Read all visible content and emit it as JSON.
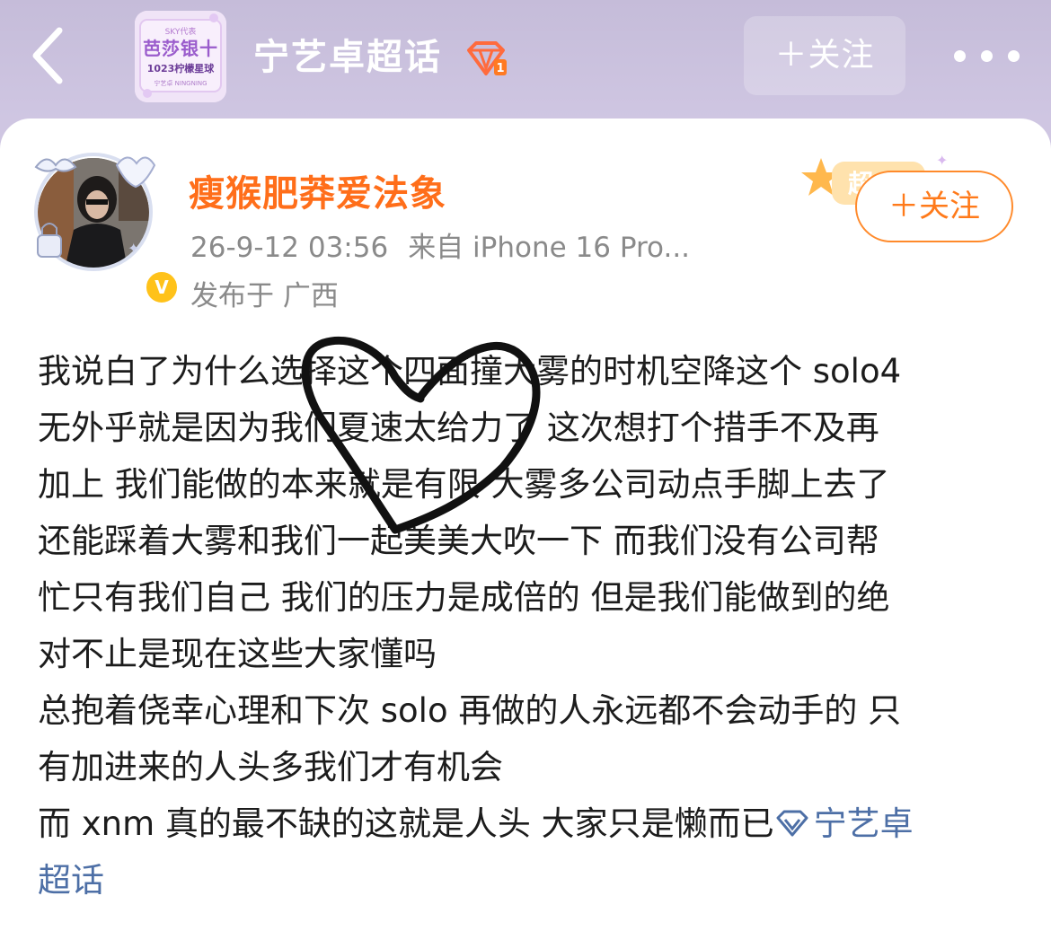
{
  "header": {
    "title": "宁艺卓超话",
    "follow_label": "＋关注",
    "thumb": {
      "top_text": "SKY代表",
      "main_text": "芭莎银十",
      "sub_text": "1023柠檬星球",
      "tiny_text": "宁艺卓 NINGNING"
    },
    "icons": {
      "back": "chevron-left-icon",
      "diamond": "diamond-badge-icon",
      "more": "more-dots-icon"
    }
  },
  "post": {
    "author": "瘦猴肥莽爱法象",
    "timestamp": "26-9-12 03:56",
    "source": "来自 iPhone 16 Pro...",
    "location": "发布于 广西",
    "follow_label": "＋关注",
    "verified_mark": "V",
    "lines": [
      "我说白了为什么选择这个四面撞大雾的时机空降这个 solo4",
      "无外乎就是因为我们夏速太给力了 这次想打个措手不及再",
      "加上 我们能做的本来就是有限 大雾多公司动点手脚上去了",
      "还能踩着大雾和我们一起美美大吹一下 而我们没有公司帮",
      "忙只有我们自己 我们的压力是成倍的 但是我们能做到的绝",
      "对不止是现在这些大家懂吗",
      "总抱着侥幸心理和下次 solo 再做的人永远都不会动手的 只",
      "有加进来的人头多我们才有机会",
      "而 xnm 真的最不缺的这就是人头 大家只是懒而已"
    ],
    "topic_link": "宁艺卓",
    "topic_link_tail": "超话"
  },
  "colors": {
    "header_bg": "#cfc6e2",
    "username": "#ff6e1a",
    "follow_accent": "#ff7a1a",
    "link": "#4d6fa6",
    "body_text": "#1c1c1c",
    "meta_text": "#8a8a8a"
  }
}
